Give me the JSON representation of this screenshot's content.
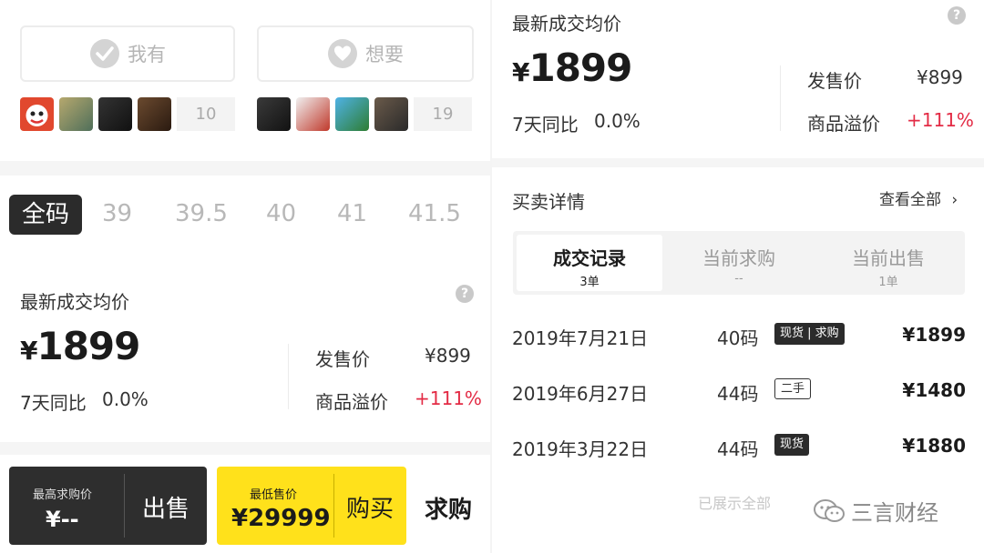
{
  "left": {
    "have_button": {
      "label": "我有",
      "count": "10"
    },
    "want_button": {
      "label": "想要",
      "count": "19"
    },
    "sizes": [
      "全码",
      "39",
      "39.5",
      "40",
      "41",
      "41.5"
    ],
    "avg_title": "最新成交均价",
    "price_symbol": "¥",
    "price_value": "1899",
    "week_label": "7天同比",
    "week_value": "0.0%",
    "retail_label": "发售价",
    "retail_value": "¥899",
    "premium_label": "商品溢价",
    "premium_value": "+111%",
    "sell_box": {
      "label": "最高求购价",
      "value": "¥--",
      "action": "出售"
    },
    "buy_box": {
      "label": "最低售价",
      "value": "¥29999",
      "action": "购买"
    },
    "seek_label": "求购"
  },
  "right": {
    "avg_title": "最新成交均价",
    "price_symbol": "¥",
    "price_value": "1899",
    "week_label": "7天同比",
    "week_value": "0.0%",
    "retail_label": "发售价",
    "retail_value": "¥899",
    "premium_label": "商品溢价",
    "premium_value": "+111%",
    "details_title": "买卖详情",
    "view_all": "查看全部",
    "tabs": [
      {
        "label": "成交记录",
        "sub": "3单"
      },
      {
        "label": "当前求购",
        "sub": "--"
      },
      {
        "label": "当前出售",
        "sub": "1单"
      }
    ],
    "records": [
      {
        "date": "2019年7月21日",
        "size": "40码",
        "tag": "现货 | 求购",
        "price": "¥1899"
      },
      {
        "date": "2019年6月27日",
        "size": "44码",
        "tag": "二手",
        "price": "¥1480"
      },
      {
        "date": "2019年3月22日",
        "size": "44码",
        "tag": "现货",
        "price": "¥1880"
      }
    ],
    "shown_all": "已展示全部"
  },
  "watermark": "三言财经",
  "colors": {
    "accent_yellow": "#ffe11b",
    "dark": "#2e2e2e",
    "red": "#e32b45"
  }
}
